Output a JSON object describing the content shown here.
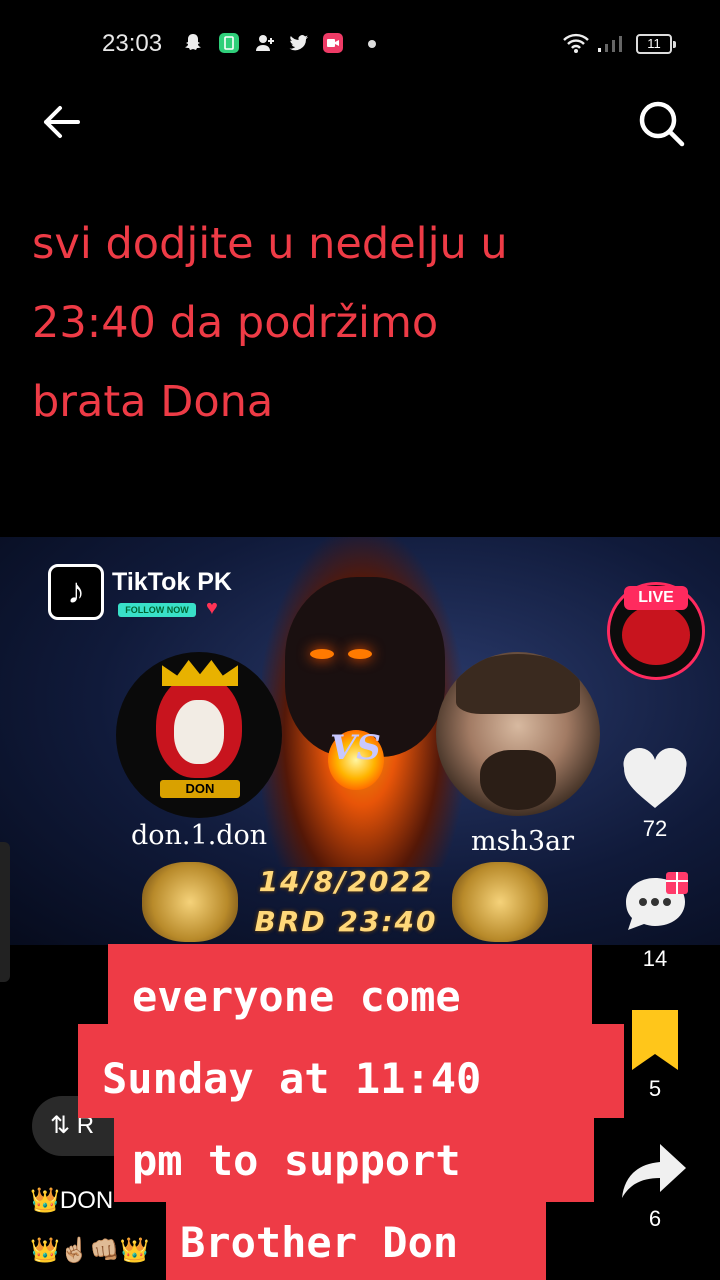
{
  "status_bar": {
    "time": "23:03",
    "battery": "11",
    "icons": [
      "snapchat-icon",
      "phone-app-icon",
      "add-user-icon",
      "twitter-icon",
      "video-icon",
      "wifi-icon",
      "signal-icon"
    ]
  },
  "nav": {
    "back_icon": "arrow-left-icon",
    "search_icon": "search-icon"
  },
  "caption": {
    "lines": [
      "svi dodjite u nedelju u",
      "23:40 da podržimo",
      "brata Dona"
    ],
    "color": "#ee3b46"
  },
  "video": {
    "brand_title": "TikTok PK",
    "follow_label": "FOLLOW NOW",
    "vs_label": "VS",
    "left_user": "don.1.don",
    "left_badge": "DON",
    "right_user": "msh3ar",
    "date": "14/8/2022",
    "time": "BRD 23:40"
  },
  "right_rail": {
    "live_label": "LIVE",
    "likes": "72",
    "comments": "14",
    "saves": "5",
    "shares": "6",
    "like_color": "#f0f0f0",
    "save_color": "#ffc61a"
  },
  "bottom": {
    "repost_label": "R",
    "comment_1": "👑DON",
    "comment_2": "👑☝🏼👊🏼👑"
  },
  "translation": {
    "lines": [
      "everyone come",
      "Sunday at 11:40",
      "pm to support",
      "Brother Don"
    ],
    "background": "#ee3b46"
  }
}
